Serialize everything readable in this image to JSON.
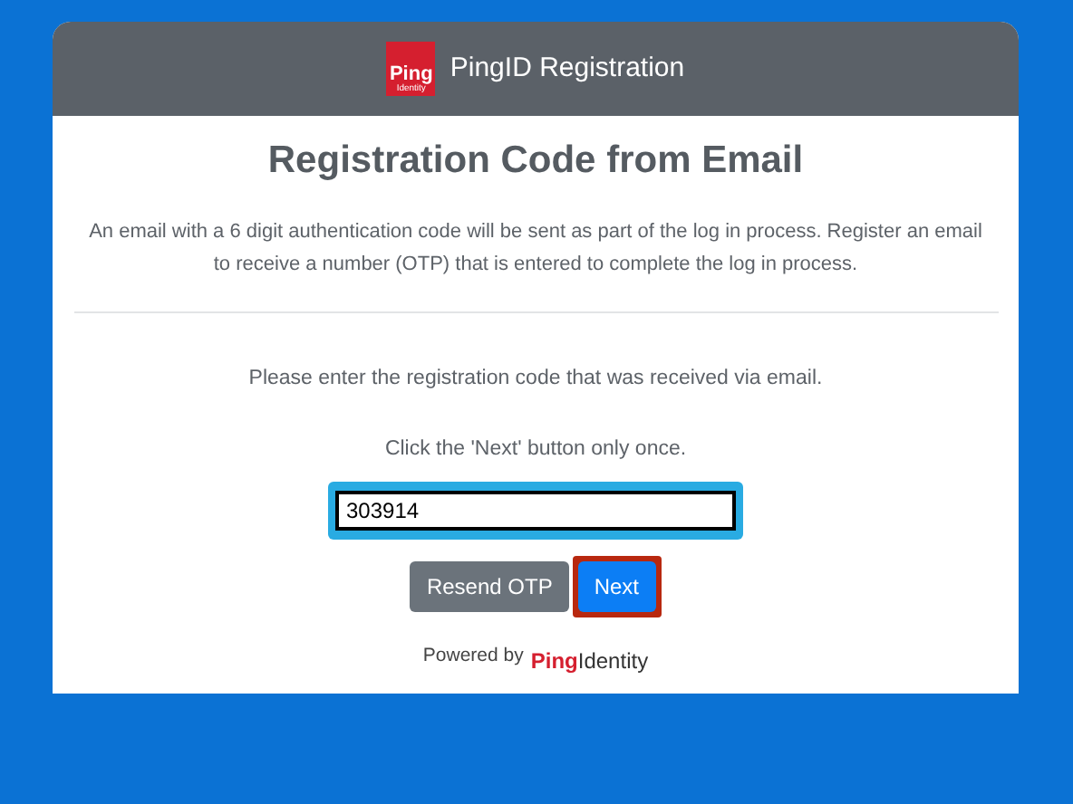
{
  "header": {
    "logo": {
      "top": "Ping",
      "bottom": "Identity"
    },
    "title": "PingID Registration"
  },
  "heading": "Registration Code from Email",
  "description": "An email with a 6 digit authentication code will be sent as part of the log in process. Register an email to receive a number (OTP) that is entered to complete the log in process.",
  "instructions": [
    "Please enter the registration code that was received via email.",
    "Click the 'Next' button only once."
  ],
  "code_field": {
    "value": "303914",
    "color": "#29abe2"
  },
  "buttons": [
    {
      "label": "Resend OTP",
      "kind": "secondary"
    },
    {
      "label": "Next",
      "kind": "primary",
      "color": "#b8280f"
    }
  ],
  "footer": {
    "text": "Powered by",
    "brand_bold": "Ping",
    "brand_rest": "Identity"
  }
}
